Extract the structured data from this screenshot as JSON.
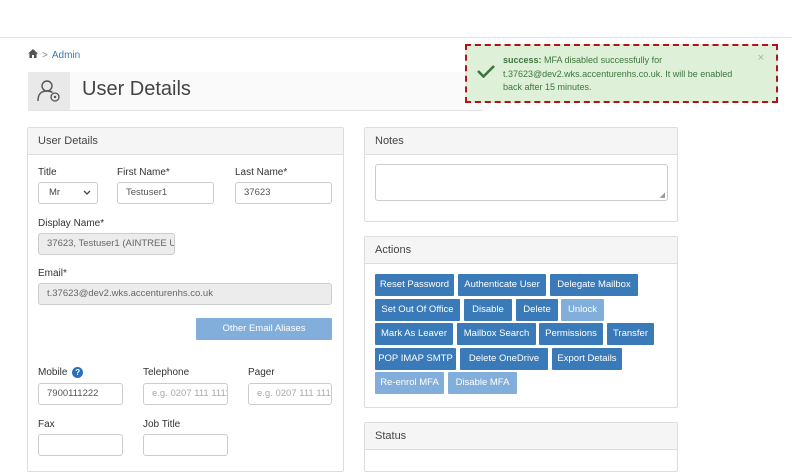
{
  "breadcrumb": {
    "home_icon": "home-icon",
    "separator": ">",
    "link": "Admin"
  },
  "header": {
    "title": "User Details",
    "icon": "user-settings-icon"
  },
  "toast": {
    "label": "success:",
    "message": " MFA disabled successfully for t.37623@dev2.wks.accenturenhs.co.uk. It will be enabled back after 15 minutes.",
    "close": "×",
    "icon": "check-icon"
  },
  "user_details": {
    "heading": "User Details",
    "title_label": "Title",
    "title_value": "Mr",
    "first_name_label": "First Name*",
    "first_name_value": "Testuser1",
    "last_name_label": "Last Name*",
    "last_name_value": "37623",
    "display_name_label": "Display Name*",
    "display_name_value": "37623, Testuser1 (AINTREE UI",
    "email_label": "Email*",
    "email_value": "t.37623@dev2.wks.accenturenhs.co.uk",
    "other_aliases_button": "Other Email Aliases",
    "mobile_label": "Mobile",
    "mobile_value": "7900111222",
    "telephone_label": "Telephone",
    "telephone_placeholder": "e.g. 0207 111 1111",
    "pager_label": "Pager",
    "pager_placeholder": "e.g. 0207 111 1111",
    "fax_label": "Fax",
    "job_title_label": "Job Title"
  },
  "notes": {
    "heading": "Notes"
  },
  "actions": {
    "heading": "Actions",
    "reset_password": "Reset Password",
    "authenticate_user": "Authenticate User",
    "delegate_mailbox": "Delegate Mailbox",
    "set_out_of_office": "Set Out Of Office",
    "disable": "Disable",
    "delete": "Delete",
    "unlock": "Unlock",
    "mark_as_leaver": "Mark As Leaver",
    "mailbox_search": "Mailbox Search",
    "permissions": "Permissions",
    "transfer": "Transfer",
    "pop_imap_smtp": "POP IMAP SMTP",
    "delete_onedrive": "Delete OneDrive",
    "export_details": "Export Details",
    "re_enrol_mfa": "Re-enrol MFA",
    "disable_mfa": "Disable MFA"
  },
  "status": {
    "heading": "Status"
  },
  "colors": {
    "primary": "#3a7ab8",
    "primary_disabled": "#82aedb",
    "success_bg": "#dff0d8",
    "success_text": "#3c763d",
    "highlight_border": "#b4121b"
  }
}
